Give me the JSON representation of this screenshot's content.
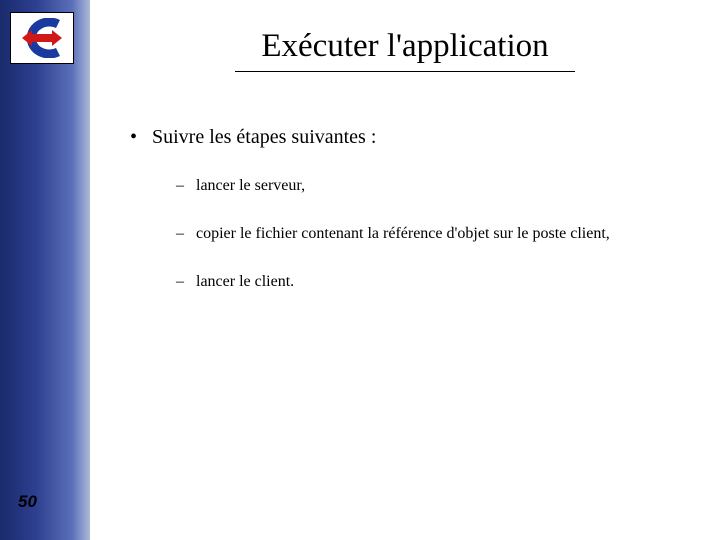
{
  "slide": {
    "title": "Exécuter l'application",
    "bullet1": "Suivre les étapes suivantes :",
    "sub": [
      "lancer le serveur,",
      "copier le fichier contenant la référence d'objet sur le poste client,",
      "lancer le client."
    ],
    "page_number": "50"
  }
}
